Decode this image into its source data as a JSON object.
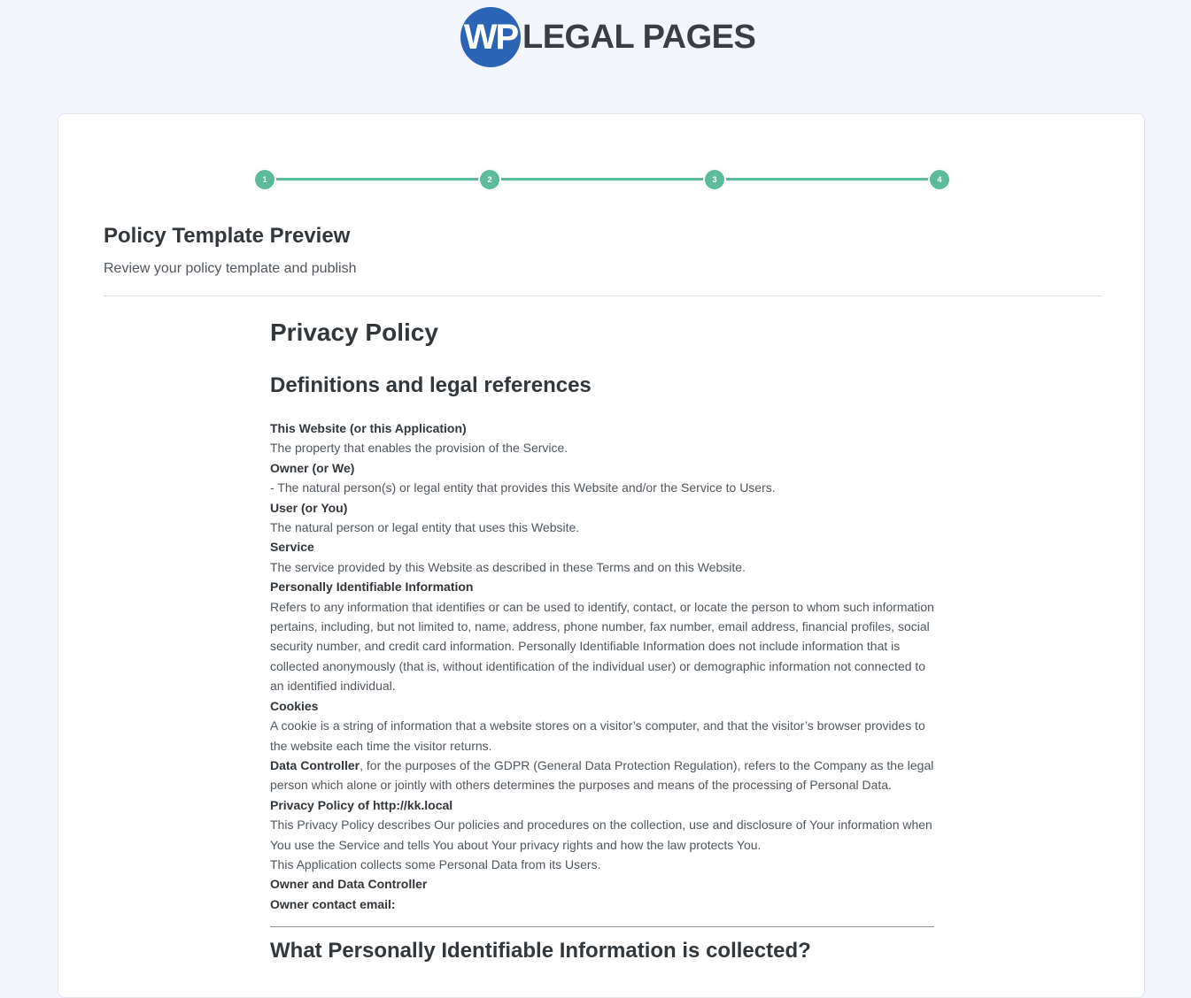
{
  "logo": {
    "badge": "WP",
    "text": "LEGAL PAGES"
  },
  "stepper": {
    "steps": [
      "1",
      "2",
      "3",
      "4"
    ]
  },
  "header": {
    "title": "Policy Template Preview",
    "subtitle": "Review your policy template and publish"
  },
  "policy": {
    "title": "Privacy Policy",
    "section1_title": "Definitions and legal references",
    "definitions": [
      {
        "term": "This Website (or this Application)",
        "desc": "The property that enables the provision of the Service."
      },
      {
        "term": "Owner (or We)",
        "desc": "- The natural person(s) or legal entity that provides this Website and/or the Service to Users."
      },
      {
        "term": "User (or You)",
        "desc": "The natural person or legal entity that uses this Website."
      },
      {
        "term": "Service",
        "desc": "The service provided by this Website as described in these Terms and on this Website."
      },
      {
        "term": "Personally Identifiable Information",
        "desc": "Refers to any information that identifies or can be used to identify, contact, or locate the person to whom such information pertains, including, but not limited to, name, address, phone number, fax number, email address, financial profiles, social security number, and credit card information. Personally Identifiable Information does not include information that is collected anonymously (that is, without identification of the individual user) or demographic information not connected to an identified individual."
      },
      {
        "term": "Cookies",
        "desc": "A cookie is a string of information that a website stores on a visitor’s computer, and that the visitor’s browser provides to the website each time the visitor returns."
      }
    ],
    "data_controller_term": "Data Controller",
    "data_controller_desc": ", for the purposes of the GDPR (General Data Protection Regulation), refers to the Company as the legal person which alone or jointly with others determines the purposes and means of the processing of Personal Data.",
    "privacy_policy_of": "Privacy Policy of http://kk.local",
    "privacy_desc": "This Privacy Policy describes Our policies and procedures on the collection, use and disclosure of Your information when You use the Service and tells You about Your privacy rights and how the law protects You.",
    "collects": "This Application collects some Personal Data from its Users.",
    "owner_controller": "Owner and Data Controller",
    "owner_email": "Owner contact email:",
    "section2_title": "What Personally Identifiable Information is collected?"
  }
}
